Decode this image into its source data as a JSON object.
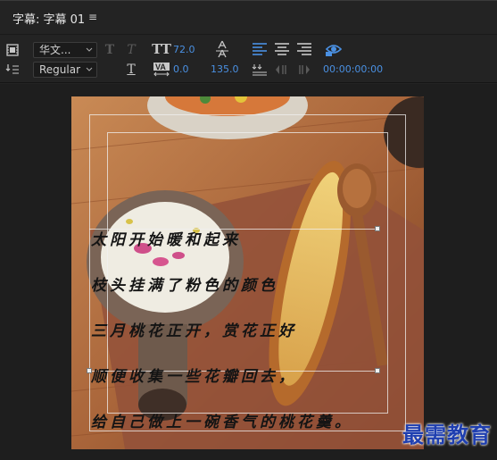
{
  "panel": {
    "tab_title": "字幕: 字幕 01",
    "menu_glyph": "≡"
  },
  "toolbar": {
    "font_family": "华文...",
    "font_style": "Regular",
    "font_size": "72.0",
    "tracking": "0.0",
    "leading": "135.0",
    "timecode": "00:00:00:00",
    "icons": {
      "roll_crawl": "film-icon",
      "tab_stops": "tab-stops-icon",
      "bold": "bold-T-icon",
      "italic": "italic-T-icon",
      "underline": "underline-T-icon",
      "font_size": "font-size-icon",
      "kerning": "kerning-icon",
      "leading": "leading-icon",
      "align_left": "align-left-icon",
      "align_center": "align-center-icon",
      "align_right": "align-right-icon",
      "tab_align": "tab-align-icon",
      "show_video": "eye-icon"
    },
    "accent_color": "#4a90e2"
  },
  "subtitles": [
    "太阳开始暖和起来",
    "枝头挂满了粉色的颜色",
    "三月桃花正开，赏花正好",
    "顺便收集一些花瓣回去，",
    "给自己做上一碗香气的桃花羹。"
  ],
  "watermark": "最需教育"
}
